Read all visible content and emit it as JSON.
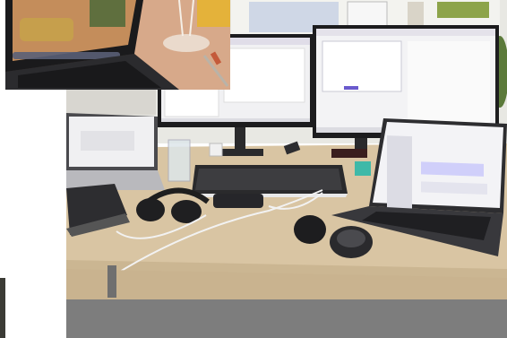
{
  "scene": {
    "description_type": "photo-collage",
    "colors": {
      "wall": "#e9e9e4",
      "desk": "#dcc8a6",
      "desk_shadow": "#bfa985",
      "floor_bar": "#7d7d7d",
      "monitor_bezel": "#1c1c1e",
      "screen": "#f2f2f4",
      "laptop_dark": "#3a3a3e",
      "inset_warm": "#c98a4e"
    }
  }
}
